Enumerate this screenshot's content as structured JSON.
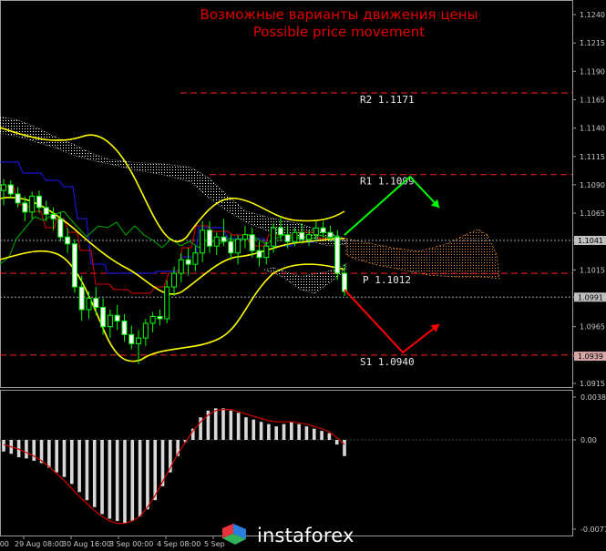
{
  "title": {
    "line1": "Возможные варианты движения цены",
    "line2": "Possible price movement"
  },
  "watermark": {
    "text": "instaforex"
  },
  "colors": {
    "background": "#000000",
    "title": "#e00000",
    "bollinger": "#ffff00",
    "kumo_bullish": "#ffffff",
    "kumo_bearish": "#e08a3c",
    "tenkan": "#ff0000",
    "kijun": "#0000ff",
    "chikou": "#00c000",
    "candle": "#00ff00",
    "candle_bear": "#ffffff",
    "bull_arrow": "#00ff00",
    "bear_arrow": "#ff0000",
    "level": "#ff2020"
  },
  "chart_data": [
    {
      "type": "candlestick",
      "panel": "price",
      "y_ticks": [
        "1.1240",
        "1.1215",
        "1.1190",
        "1.1165",
        "1.1140",
        "1.1115",
        "1.1090",
        "1.1065",
        "1.1041",
        "1.1015",
        "1.0991",
        "1.0965",
        "1.0939",
        "1.0915"
      ],
      "ylim": [
        1.0905,
        1.125
      ],
      "x_ticks": [
        "29 Aug 08:00",
        "30 Aug 16:00",
        "3 Sep 00:00",
        "4 Sep 08:00",
        "5 Sep"
      ],
      "x_tick_first_partial": ":00",
      "price_tags": [
        {
          "value": "1.1041",
          "color": "#c0c0c0",
          "num": 1.1041
        },
        {
          "value": "1.0991",
          "color": "#c0c0c0",
          "num": 1.0991
        },
        {
          "value": "1.0939",
          "color": "#d8a8a8",
          "num": 1.0939
        }
      ],
      "levels": [
        {
          "name": "R2",
          "label": "R2 1.1171",
          "value": 1.1171
        },
        {
          "name": "R1",
          "label": "R1 1.1099",
          "value": 1.1099
        },
        {
          "name": "P",
          "label": "P 1.1012",
          "value": 1.1012
        },
        {
          "name": "S1",
          "label": "S1 1.0940",
          "value": 1.094
        }
      ],
      "grey_lines": [
        1.1041,
        1.0991
      ],
      "candles": [
        [
          1.1085,
          1.1095,
          1.1072,
          1.109
        ],
        [
          1.109,
          1.1094,
          1.1078,
          1.1082
        ],
        [
          1.1082,
          1.1088,
          1.107,
          1.1074
        ],
        [
          1.1074,
          1.108,
          1.1058,
          1.1066
        ],
        [
          1.1066,
          1.1084,
          1.106,
          1.108
        ],
        [
          1.108,
          1.1085,
          1.1065,
          1.107
        ],
        [
          1.107,
          1.1076,
          1.1058,
          1.1064
        ],
        [
          1.1064,
          1.107,
          1.105,
          1.106
        ],
        [
          1.106,
          1.1066,
          1.104,
          1.1044
        ],
        [
          1.1044,
          1.1052,
          1.103,
          1.1038
        ],
        [
          1.1038,
          1.1042,
          1.0995,
          1.1
        ],
        [
          1.1,
          1.101,
          1.097,
          1.098
        ],
        [
          1.098,
          1.0996,
          1.0972,
          1.099
        ],
        [
          1.099,
          1.1,
          1.0975,
          1.0982
        ],
        [
          1.0982,
          1.099,
          1.0958,
          1.0965
        ],
        [
          1.0965,
          1.098,
          1.0955,
          1.0975
        ],
        [
          1.0975,
          1.0984,
          1.0962,
          1.097
        ],
        [
          1.097,
          1.0976,
          1.0952,
          1.0958
        ],
        [
          1.0958,
          1.0966,
          1.0945,
          1.095
        ],
        [
          1.095,
          1.0962,
          1.0932,
          1.0955
        ],
        [
          1.0955,
          1.0972,
          1.0948,
          1.0968
        ],
        [
          1.0968,
          1.0978,
          1.096,
          1.0974
        ],
        [
          1.0974,
          1.098,
          1.0966,
          1.0972
        ],
        [
          1.0972,
          1.1006,
          1.0968,
          1.1
        ],
        [
          1.1,
          1.1018,
          1.0992,
          1.1012
        ],
        [
          1.1012,
          1.103,
          1.1004,
          1.1024
        ],
        [
          1.1024,
          1.1034,
          1.101,
          1.102
        ],
        [
          1.102,
          1.1036,
          1.1014,
          1.103
        ],
        [
          1.103,
          1.1058,
          1.1022,
          1.105
        ],
        [
          1.105,
          1.1058,
          1.103,
          1.1036
        ],
        [
          1.1036,
          1.1048,
          1.1028,
          1.1044
        ],
        [
          1.1044,
          1.106,
          1.1036,
          1.104
        ],
        [
          1.104,
          1.1046,
          1.1024,
          1.103
        ],
        [
          1.103,
          1.1046,
          1.102,
          1.1042
        ],
        [
          1.1042,
          1.1054,
          1.1034,
          1.1046
        ],
        [
          1.1046,
          1.1052,
          1.1026,
          1.1032
        ],
        [
          1.1032,
          1.104,
          1.1018,
          1.1026
        ],
        [
          1.1026,
          1.104,
          1.102,
          1.1036
        ],
        [
          1.1036,
          1.1056,
          1.103,
          1.1052
        ],
        [
          1.1052,
          1.1062,
          1.104,
          1.1046
        ],
        [
          1.1046,
          1.1054,
          1.1034,
          1.104
        ],
        [
          1.104,
          1.1052,
          1.1036,
          1.1048
        ],
        [
          1.1048,
          1.1056,
          1.1038,
          1.1042
        ],
        [
          1.1042,
          1.105,
          1.1036,
          1.1046
        ],
        [
          1.1046,
          1.1058,
          1.104,
          1.1052
        ],
        [
          1.1052,
          1.1058,
          1.1044,
          1.1048
        ],
        [
          1.1048,
          1.1054,
          1.104,
          1.1044
        ],
        [
          1.1044,
          1.105,
          1.1006,
          1.1012
        ],
        [
          1.1012,
          1.102,
          1.0992,
          1.0996
        ]
      ],
      "forecast_arrows": [
        {
          "direction": "up",
          "path": [
            [
              378,
              258
            ],
            [
              450,
              194
            ],
            [
              482,
              228
            ]
          ]
        },
        {
          "direction": "down",
          "path": [
            [
              378,
              318
            ],
            [
              442,
              387
            ],
            [
              482,
              356
            ]
          ]
        }
      ]
    },
    {
      "type": "histogram",
      "panel": "oscillator",
      "y_ticks": [
        "0.0038",
        "0.00",
        "-0.0077"
      ],
      "ylim": [
        -0.0077,
        0.0038
      ],
      "histogram": [
        -0.001,
        -0.0012,
        -0.0015,
        -0.0016,
        -0.0018,
        -0.002,
        -0.0024,
        -0.0028,
        -0.0032,
        -0.0038,
        -0.0045,
        -0.0052,
        -0.0058,
        -0.0064,
        -0.0068,
        -0.007,
        -0.0072,
        -0.007,
        -0.0066,
        -0.006,
        -0.0052,
        -0.004,
        -0.0028,
        -0.0014,
        -0.0002,
        0.001,
        0.002,
        0.0026,
        0.0028,
        0.0028,
        0.0026,
        0.0024,
        0.002,
        0.0018,
        0.0016,
        0.0014,
        0.0012,
        0.0014,
        0.0016,
        0.0014,
        0.0012,
        0.001,
        0.0008,
        0.0006,
        -0.0004,
        -0.0014
      ],
      "signal": [
        -0.0004,
        -0.0006,
        -0.0008,
        -0.0011,
        -0.0014,
        -0.0018,
        -0.0023,
        -0.0029,
        -0.0035,
        -0.0042,
        -0.0049,
        -0.0055,
        -0.0061,
        -0.0066,
        -0.007,
        -0.0072,
        -0.0072,
        -0.007,
        -0.0066,
        -0.0058,
        -0.0048,
        -0.0036,
        -0.0024,
        -0.0012,
        -0.0002,
        0.0008,
        0.0016,
        0.0022,
        0.0026,
        0.0027,
        0.0027,
        0.0025,
        0.0023,
        0.0021,
        0.0019,
        0.0017,
        0.0016,
        0.0016,
        0.0016,
        0.0015,
        0.0014,
        0.0012,
        0.001,
        0.0007,
        0.0002,
        -0.0004
      ]
    }
  ]
}
